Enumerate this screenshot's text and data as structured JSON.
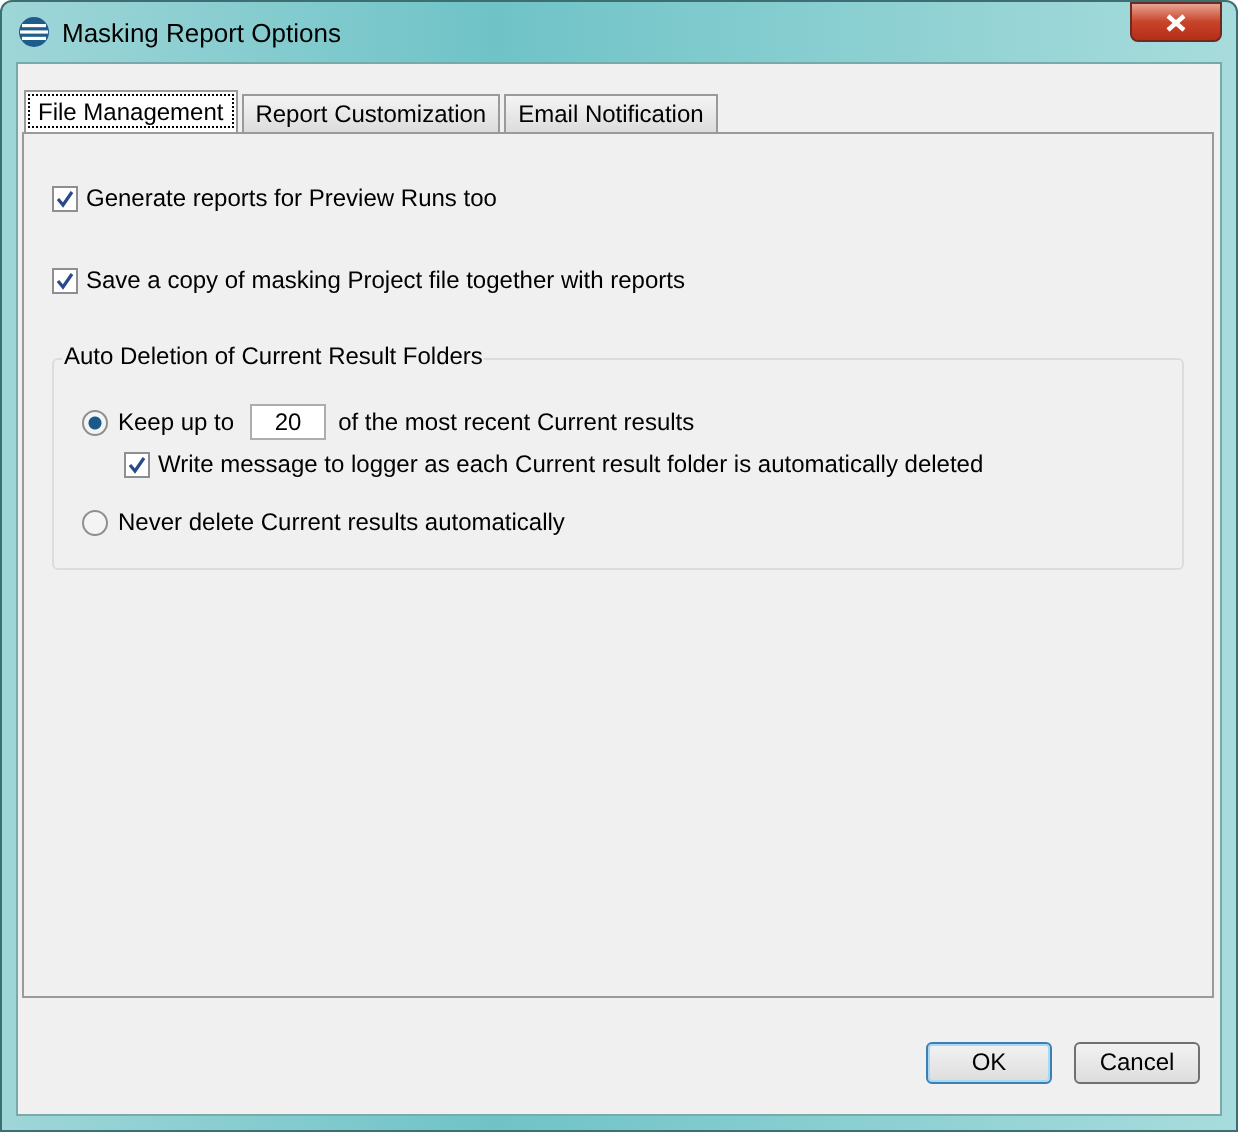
{
  "window": {
    "title": "Masking Report Options"
  },
  "tabs": [
    {
      "label": "File Management",
      "selected": true
    },
    {
      "label": "Report Customization",
      "selected": false
    },
    {
      "label": "Email Notification",
      "selected": false
    }
  ],
  "options": [
    {
      "label": "Generate reports for Preview Runs too",
      "checked": true
    },
    {
      "label": "Save a copy of masking Project file together with reports",
      "checked": true
    }
  ],
  "group": {
    "title": "Auto Deletion of Current Result Folders",
    "items": [
      {
        "kind": "radio",
        "selected": true,
        "label": "Keep up to",
        "value": "20",
        "suffix": "of the most recent Current results"
      },
      {
        "kind": "checkbox",
        "checked": true,
        "label": "Write message to logger as each Current result folder is automatically deleted"
      },
      {
        "kind": "radio",
        "selected": false,
        "label": "Never delete Current results automatically"
      }
    ]
  },
  "buttons": [
    {
      "label": "OK",
      "default": true
    },
    {
      "label": "Cancel",
      "default": false
    }
  ]
}
